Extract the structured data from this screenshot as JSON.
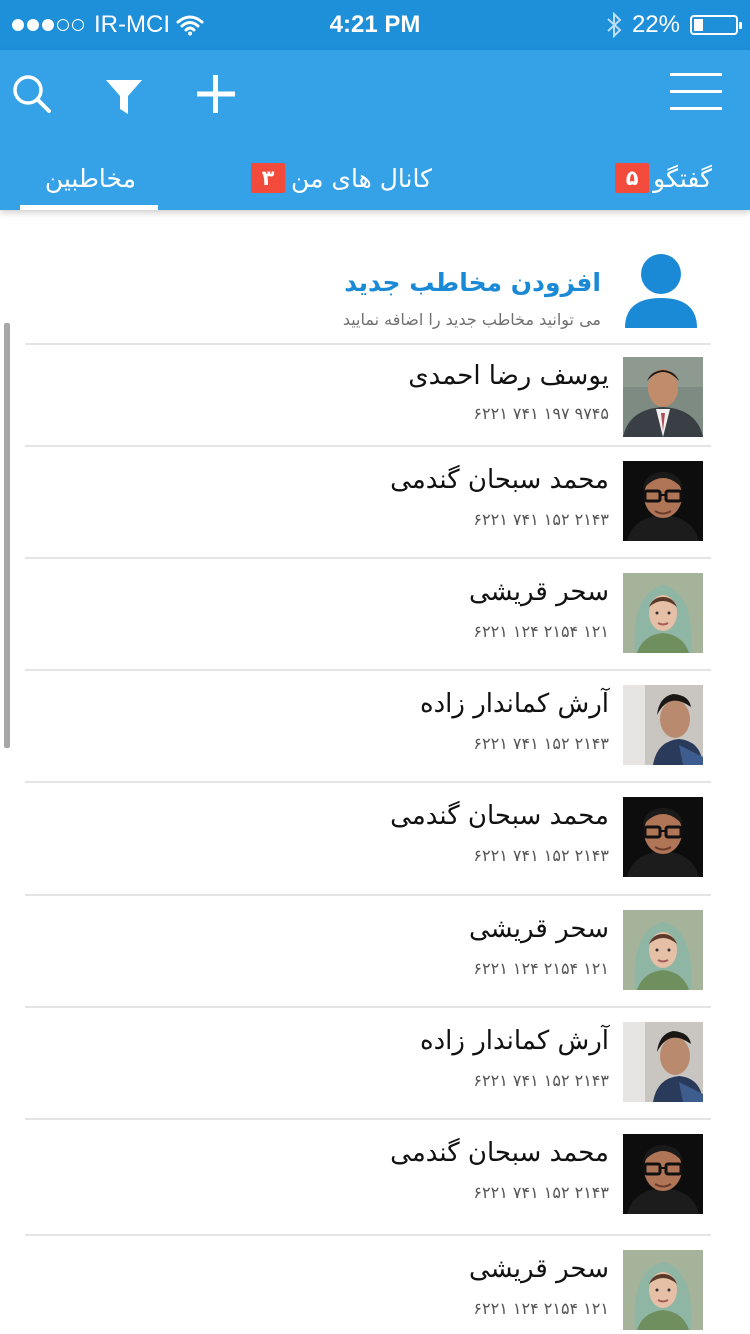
{
  "status_bar": {
    "carrier": "IR-MCI",
    "time": "4:21 PM",
    "battery": "22%",
    "battery_level": 0.22,
    "signal_dots_filled": 3,
    "signal_dots_total": 5,
    "icons": [
      "wifi-icon",
      "bluetooth-icon",
      "battery-icon"
    ]
  },
  "header": {
    "icons": [
      "search-icon",
      "filter-icon",
      "plus-icon",
      "menu-icon"
    ],
    "accent_color": "#35a1e7",
    "tabs": [
      {
        "label": "گفتگو",
        "badge": "۵"
      },
      {
        "label": "کانال های من",
        "badge": "۳"
      },
      {
        "label": "مخاطبین",
        "active": true
      }
    ]
  },
  "add_contact": {
    "title": "افزودن مخاطب جدید",
    "subtitle": "می توانید مخاطب جدید را اضافه نمایید"
  },
  "contacts": [
    {
      "name": "یوسف رضا احمدی",
      "phone": "۶۲۲۱ ۷۴۱ ۱۹۷ ۹۷۴۵",
      "photo": "man-suit-photo"
    },
    {
      "name": "محمد سبحان گندمی",
      "phone": "۶۲۲۱ ۷۴۱ ۱۵۲ ۲۱۴۳",
      "photo": "man-glasses-photo"
    },
    {
      "name": "سحر قریشی",
      "phone": "۶۲۲۱ ۱۲۴ ۲۱۵۴ ۱۲۱",
      "photo": "woman-scarf-photo"
    },
    {
      "name": "آرش کماندار زاده",
      "phone": "۶۲۲۱ ۷۴۱ ۱۵۲ ۲۱۴۳",
      "photo": "man-profile-photo"
    },
    {
      "name": "محمد سبحان گندمی",
      "phone": "۶۲۲۱ ۷۴۱ ۱۵۲ ۲۱۴۳",
      "photo": "man-glasses-photo"
    },
    {
      "name": "سحر قریشی",
      "phone": "۶۲۲۱ ۱۲۴ ۲۱۵۴ ۱۲۱",
      "photo": "woman-scarf-photo"
    },
    {
      "name": "آرش کماندار زاده",
      "phone": "۶۲۲۱ ۷۴۱ ۱۵۲ ۲۱۴۳",
      "photo": "man-profile-photo"
    },
    {
      "name": "محمد سبحان گندمی",
      "phone": "۶۲۲۱ ۷۴۱ ۱۵۲ ۲۱۴۳",
      "photo": "man-glasses-photo"
    },
    {
      "name": "سحر قریشی",
      "phone": "۶۲۲۱ ۱۲۴ ۲۱۵۴ ۱۲۱",
      "photo": "woman-scarf-photo"
    }
  ]
}
